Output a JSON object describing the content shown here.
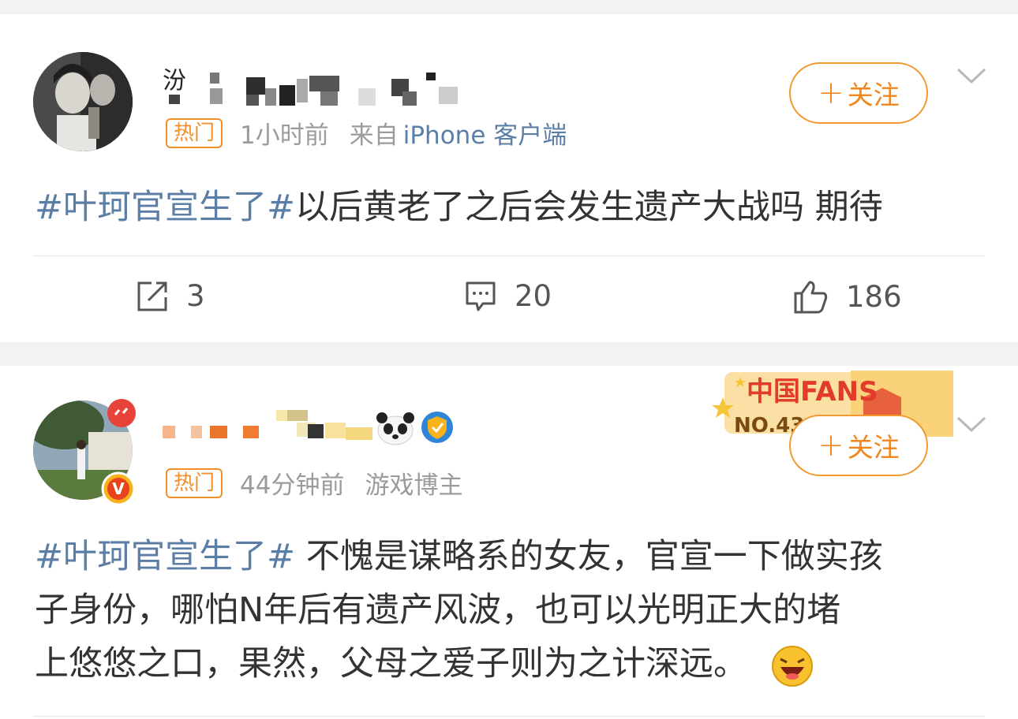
{
  "posts": [
    {
      "hot_label": "热门",
      "time": "1小时前",
      "source_prefix": "来自",
      "source_link": "iPhone 客户端",
      "follow_label": "关注",
      "hashtag": "#叶珂官宣生了#",
      "text": "以后黄老了之后会发生遗产大战吗 期待",
      "repost_count": "3",
      "comment_count": "20",
      "like_count": "186",
      "icons": [
        "avatar-photo",
        "repost-icon",
        "comment-icon",
        "like-icon",
        "chevron-down-icon"
      ]
    },
    {
      "hot_label": "热门",
      "time": "44分钟前",
      "source": "游戏博主",
      "follow_label": "关注",
      "badge_text": "中国FANS",
      "badge_rank": "NO.43",
      "hashtag": "#叶珂官宣生了#",
      "lines": [
        " 不愧是谋略系的女友，官宣一下做实孩",
        "子身份，哪怕N年后有遗产风波，也可以光明正大的堵",
        "上悠悠之口，果然，父母之爱子则为之计深远。"
      ],
      "icons": [
        "verified-v-icon",
        "panda-emoji-icon",
        "shield-badge-icon",
        "laughing-emoji-icon"
      ]
    }
  ],
  "colors": {
    "accent_orange": "#f0861d",
    "link_blue": "#5b7ea6",
    "text": "#333333",
    "meta_gray": "#9b9b9b"
  }
}
